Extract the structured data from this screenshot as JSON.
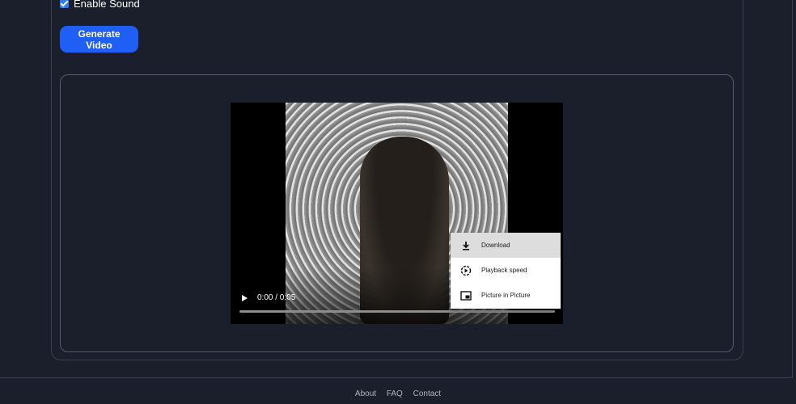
{
  "form": {
    "enable_sound_label": "Enable Sound",
    "enable_sound_checked": true,
    "generate_button_label": "Generate Video"
  },
  "player": {
    "time_display": "0:00 / 0:05",
    "progress": 0
  },
  "context_menu": {
    "items": [
      {
        "label": "Download",
        "icon": "download-icon",
        "highlighted": true
      },
      {
        "label": "Playback speed",
        "icon": "playback-speed-icon",
        "highlighted": false
      },
      {
        "label": "Picture in Picture",
        "icon": "picture-in-picture-icon",
        "highlighted": false
      }
    ]
  },
  "footer": {
    "links": [
      "About",
      "FAQ",
      "Contact"
    ]
  },
  "colors": {
    "background": "#1b1f2b",
    "accent": "#1f5ff6",
    "checkbox": "#2f7bf5"
  }
}
